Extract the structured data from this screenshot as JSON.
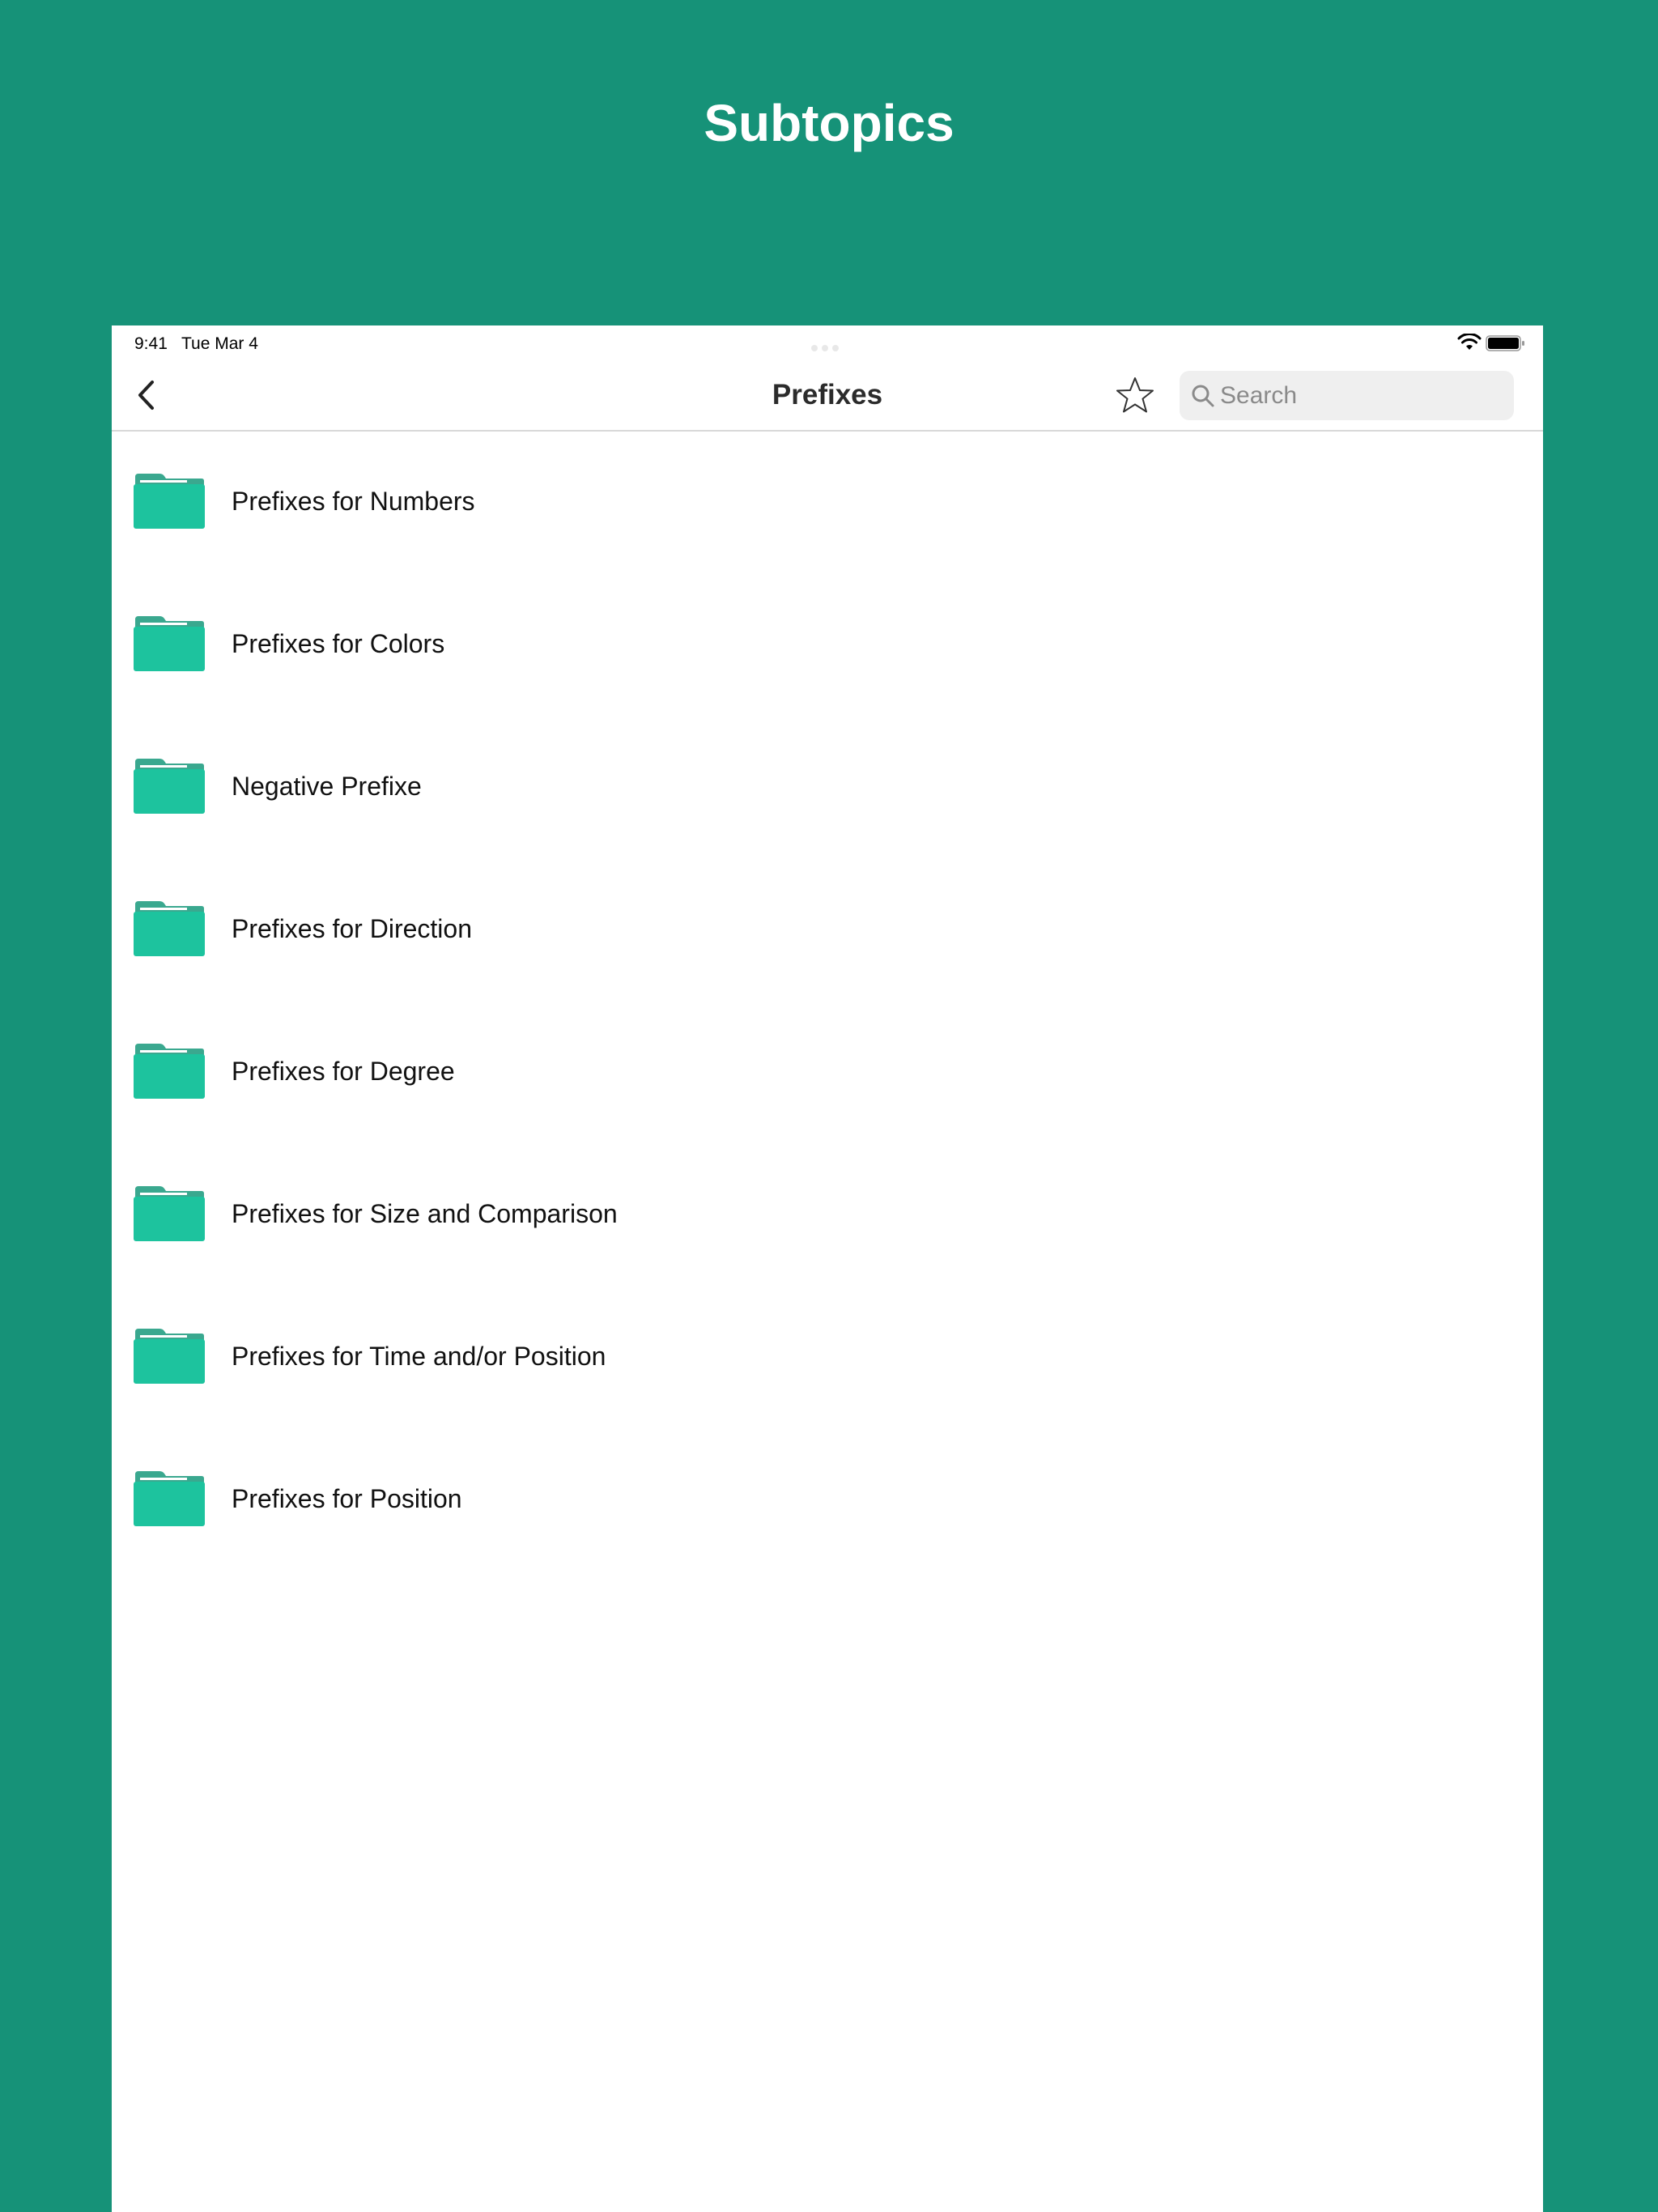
{
  "promo": {
    "title": "Subtopics"
  },
  "status_bar": {
    "time": "9:41   Tue Mar 4",
    "wifi_icon": "wifi-icon",
    "battery_icon": "battery-icon"
  },
  "nav": {
    "back_icon": "chevron-left-icon",
    "title": "Prefixes",
    "favorite_icon": "star-outline-icon"
  },
  "search": {
    "placeholder": "Search",
    "value": "",
    "icon": "search-icon"
  },
  "topics": [
    {
      "label": "Prefixes for Numbers",
      "icon": "folder-icon"
    },
    {
      "label": "Prefixes for Colors",
      "icon": "folder-icon"
    },
    {
      "label": "Negative Prefixe",
      "icon": "folder-icon"
    },
    {
      "label": "Prefixes for Direction",
      "icon": "folder-icon"
    },
    {
      "label": "Prefixes for Degree",
      "icon": "folder-icon"
    },
    {
      "label": "Prefixes for Size and Comparison",
      "icon": "folder-icon"
    },
    {
      "label": "Prefixes for Time and/or Position",
      "icon": "folder-icon"
    },
    {
      "label": "Prefixes for Position",
      "icon": "folder-icon"
    }
  ],
  "colors": {
    "background": "#169278",
    "folder": "#1dc39e",
    "folder_tab": "#3aa88f"
  }
}
